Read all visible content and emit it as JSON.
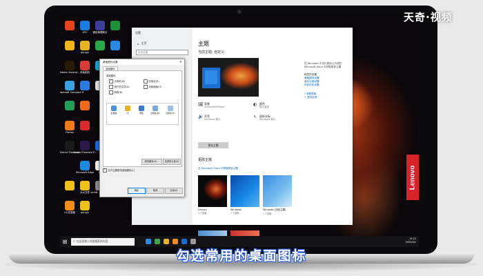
{
  "watermark": "天奇·视频",
  "caption": "勾选常用的桌面图标",
  "lenovo_logo": "Lenovo",
  "desktop_icons": [
    {
      "label": "",
      "color": "#e8451f",
      "col": 0,
      "row": 0
    },
    {
      "label": "KTC",
      "color": "#1a7be0",
      "col": 1,
      "row": 0
    },
    {
      "label": "微信清理助手",
      "color": "#3d3d9a",
      "col": 2,
      "row": 0
    },
    {
      "label": "",
      "color": "#1f8f3a",
      "col": 3,
      "row": 0
    },
    {
      "label": "",
      "color": "#f0b41a",
      "col": 0,
      "row": 1
    },
    {
      "label": "gongju",
      "color": "#e6b422",
      "col": 1,
      "row": 1
    },
    {
      "label": "",
      "color": "#2aa84a",
      "col": 2,
      "row": 1
    },
    {
      "label": "",
      "color": "#2a8ae0",
      "col": 3,
      "row": 1
    },
    {
      "label": "Adobe Illustrat...",
      "color": "#2a1a08",
      "col": 0,
      "row": 2
    },
    {
      "label": "赤兔相机",
      "color": "#d93a3a",
      "col": 1,
      "row": 2
    },
    {
      "label": "",
      "color": "#1aa0c8",
      "col": 2,
      "row": 2
    },
    {
      "label": "Apowersoft Compare H",
      "color": "#3aa0e0",
      "col": 0,
      "row": 3
    },
    {
      "label": "",
      "color": "#2a7ae0",
      "col": 1,
      "row": 3
    },
    {
      "label": "",
      "color": "#e0e0e0",
      "col": 2,
      "row": 3
    },
    {
      "label": "",
      "color": "#20a058",
      "col": 0,
      "row": 4
    },
    {
      "label": "",
      "color": "#f06a1a",
      "col": 1,
      "row": 4
    },
    {
      "label": "Firefox",
      "color": "#f07a1a",
      "col": 0,
      "row": 5
    },
    {
      "label": "",
      "color": "#d82a2a",
      "col": 1,
      "row": 5
    },
    {
      "label": "Marvel Premium",
      "color": "#1a1a1a",
      "col": 0,
      "row": 6
    },
    {
      "label": "Adobe Premiere P...",
      "color": "#2a1a4a",
      "col": 1,
      "row": 6
    },
    {
      "label": "",
      "color": "#1a6ad8",
      "col": 2,
      "row": 6
    },
    {
      "label": "Microsoft Edge",
      "color": "#1a8ae0",
      "col": 1,
      "row": 7
    },
    {
      "label": "1.8",
      "color": "#f0f0f0",
      "col": 2,
      "row": 7
    },
    {
      "label": "",
      "color": "#f0c01a",
      "col": 0,
      "row": 8
    },
    {
      "label": "大大文件",
      "color": "#f0c01a",
      "col": 1,
      "row": 8
    },
    {
      "label": "xcraft - 快捷方式",
      "color": "#888888",
      "col": 2,
      "row": 8
    },
    {
      "label": "UC浏览器",
      "color": "#f08a1a",
      "col": 0,
      "row": 9
    },
    {
      "label": "gongju",
      "color": "#f0c01a",
      "col": 1,
      "row": 9
    }
  ],
  "settings": {
    "window_title": "设置",
    "home": "主页",
    "search_placeholder": "查找设置",
    "heading": "主题",
    "subheading": "当前主题: 自定义",
    "options": [
      {
        "icon": "🖼",
        "title": "背景",
        "value": "SettingWallPaper"
      },
      {
        "icon": "◐",
        "title": "颜色",
        "value": "默认蓝色"
      },
      {
        "icon": "🔊",
        "title": "声音",
        "value": "Windows 默认"
      },
      {
        "icon": "↖",
        "title": "鼠标光标",
        "value": "Windows 默认"
      }
    ],
    "save_button": "保存主题",
    "change_theme_heading": "更改主题",
    "store_link": "在 Microsoft Store 中获取更多主题",
    "themes": [
      {
        "name": "Lenovo",
        "count": "1 个图像"
      },
      {
        "name": "Windows",
        "count": "1 个图像"
      },
      {
        "name": "Windows (浅色主题)",
        "count": "1 个图像"
      }
    ],
    "related": {
      "text": "在 Windows 中进行更改以方便在 Microsoft Store 中获取更多主题",
      "heading": "相关的设置",
      "links": [
        "桌面图标设置",
        "高对比度设置",
        "同步你的设置"
      ],
      "help": [
        "获取帮助",
        "提供反馈"
      ]
    }
  },
  "dialog": {
    "title": "桌面图标设置",
    "tab": "桌面图标",
    "group_label": "桌面图标",
    "checkboxes": [
      {
        "label": "计算机(M)",
        "checked": true
      },
      {
        "label": "回收站(R)",
        "checked": false
      },
      {
        "label": "用户的文件(U)",
        "checked": false
      },
      {
        "label": "控制面板(O)",
        "checked": false
      },
      {
        "label": "网络(N)",
        "checked": false
      }
    ],
    "grid_icons": [
      {
        "label": "此电脑",
        "color": "#4a90d9"
      },
      {
        "label": "Ad",
        "color": "#e6b422"
      },
      {
        "label": "网络",
        "color": "#3a7ad0"
      },
      {
        "label": "回收站(满)",
        "color": "#7aa8d8"
      },
      {
        "label": "回收站(空)",
        "color": "#a0c0e0"
      }
    ],
    "change_icon_button": "更改图标(H)...",
    "restore_default_button": "还原默认值(S)",
    "allow_themes": "允许主题更改桌面图标(L)",
    "ok_button": "确定",
    "cancel_button": "取消",
    "apply_button": "应用(A)"
  },
  "taskbar": {
    "search_placeholder": "在这里输入你要搜索的内容",
    "apps": [
      "#2a8ae0",
      "#3aa64a",
      "#e6b422",
      "#f08a1a",
      "#1a6ad8",
      "#9a9a9a"
    ],
    "time": "15:21",
    "date": "2020/9/1"
  }
}
